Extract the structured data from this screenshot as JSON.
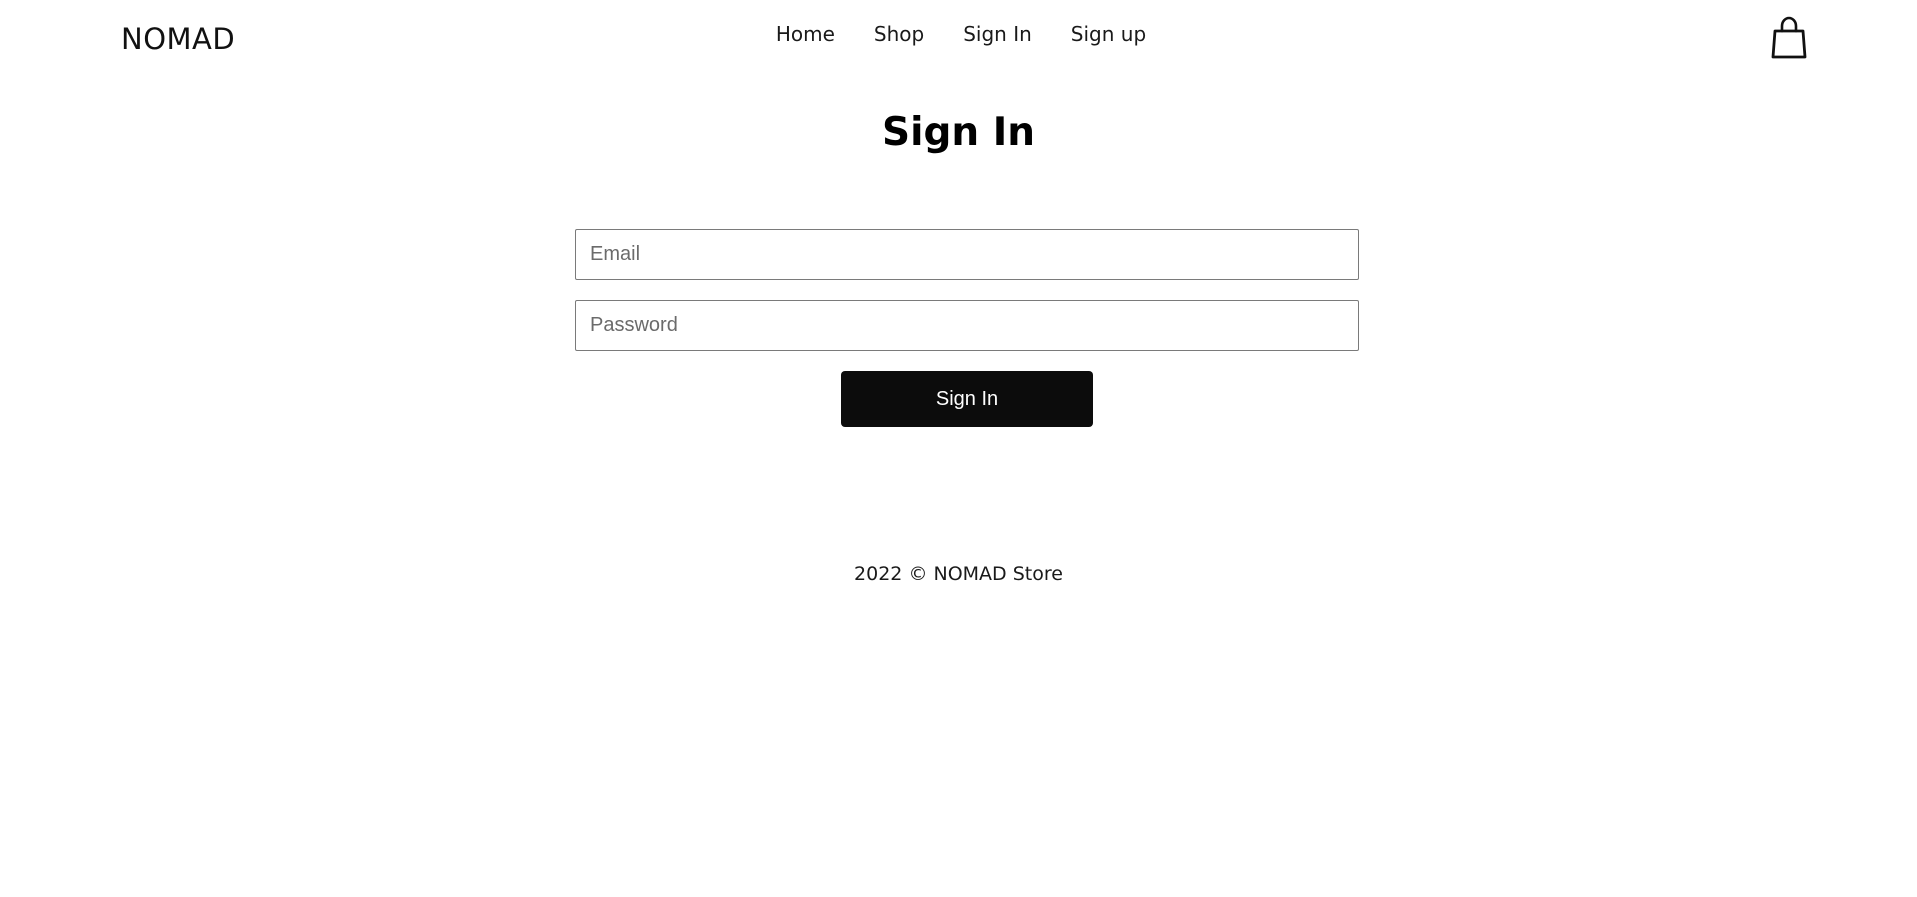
{
  "header": {
    "logo": "NOMAD",
    "nav": [
      {
        "label": "Home"
      },
      {
        "label": "Shop"
      },
      {
        "label": "Sign In"
      },
      {
        "label": "Sign up"
      }
    ],
    "cart_icon": "shopping-bag-icon"
  },
  "main": {
    "title": "Sign In",
    "email": {
      "placeholder": "Email",
      "value": ""
    },
    "password": {
      "placeholder": "Password",
      "value": ""
    },
    "submit_label": "Sign In"
  },
  "footer": {
    "text": "2022 © NOMAD Store"
  }
}
